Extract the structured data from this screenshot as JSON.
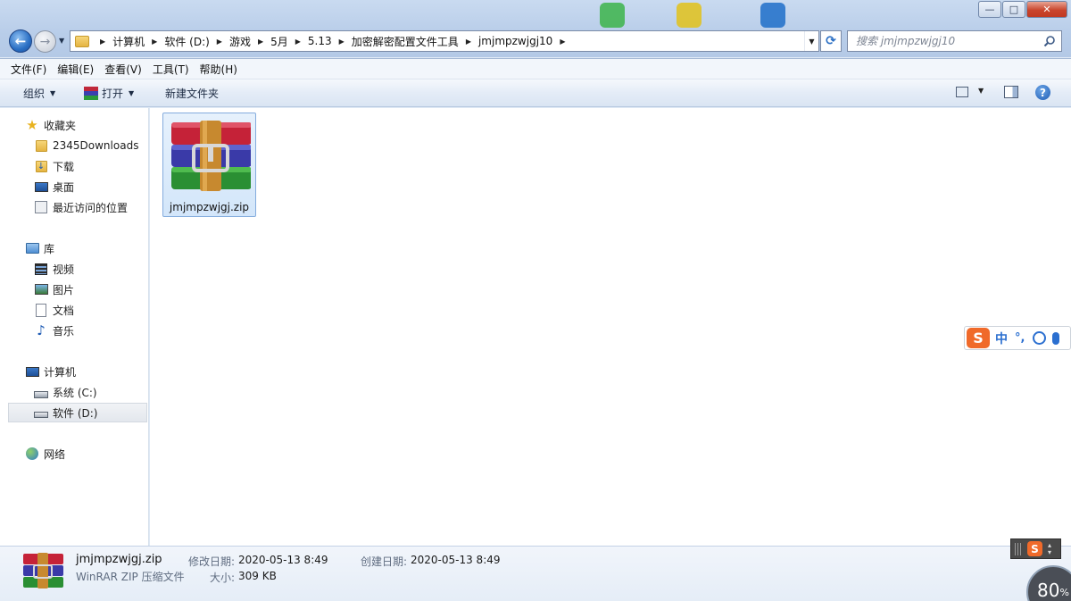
{
  "window": {
    "min_label": "—",
    "max_label": "□",
    "close_label": "✕"
  },
  "address": {
    "crumbs": [
      "计算机",
      "软件 (D:)",
      "游戏",
      "5月",
      "5.13",
      "加密解密配置文件工具",
      "jmjmpzwjgj10"
    ]
  },
  "search": {
    "placeholder": "搜索 jmjmpzwjgj10"
  },
  "menu": [
    "文件(F)",
    "编辑(E)",
    "查看(V)",
    "工具(T)",
    "帮助(H)"
  ],
  "toolbar": {
    "organize": "组织",
    "open": "打开",
    "new_folder": "新建文件夹"
  },
  "nav": {
    "favorites": "收藏夹",
    "fav_items": [
      "2345Downloads",
      "下载",
      "桌面",
      "最近访问的位置"
    ],
    "libraries": "库",
    "lib_items": [
      "视频",
      "图片",
      "文档",
      "音乐"
    ],
    "computer": "计算机",
    "drives": [
      "系统 (C:)",
      "软件 (D:)"
    ],
    "network": "网络"
  },
  "files": [
    {
      "name": "jmjmpzwjgj.zip",
      "icon": "winrar-archive-icon"
    }
  ],
  "details": {
    "name": "jmjmpzwjgj.zip",
    "type": "WinRAR ZIP 压缩文件",
    "modified_label": "修改日期:",
    "modified_value": "2020-05-13 8:49",
    "created_label": "创建日期:",
    "created_value": "2020-05-13 8:49",
    "size_label": "大小:",
    "size_value": "309 KB"
  },
  "ime": {
    "logo": "S",
    "mode": "中",
    "punct": "°,"
  },
  "zoom": {
    "value": "80",
    "unit": "%"
  },
  "colors": {
    "selection": "#d3e6fa",
    "accent": "#2a6fc4",
    "ime_orange": "#f06a2a"
  }
}
